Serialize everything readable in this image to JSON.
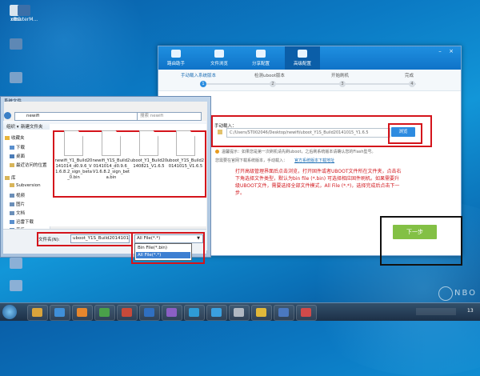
{
  "desktop": {
    "icons": [
      {
        "label": "nBO"
      },
      {
        "label": "xRouterM..."
      }
    ]
  },
  "tool_window": {
    "tabs": [
      {
        "label": "路由助手"
      },
      {
        "label": "文件浏览"
      },
      {
        "label": "分享配置"
      },
      {
        "label": "高级配置"
      }
    ],
    "steps": [
      {
        "label": "手动载入系统版本",
        "num": "1"
      },
      {
        "label": "检测uboot版本",
        "num": "2"
      },
      {
        "label": "开始刷机",
        "num": "3"
      },
      {
        "label": "完成",
        "num": "4"
      }
    ],
    "manual_load_label": "手动载入：",
    "path_value": "C:/Users/ST002046/Desktop/newifi/uboot_Y1S_Build20141015_Y1.6.5",
    "browse_label": "浏览",
    "tip": "温馨提示：如果您是第一次刷机请先刷uboot，之后刷系统版本请确认您的Flash型号。",
    "help_text": "您需要在官网下载系统版本，手动载入：",
    "help_link": "官方系统版本下载地址",
    "instructions": "打开高级管理界面后点击浏览，打开固件或者UBOOT文件所在文件夹，点击右下角选择文件类型，默认为bin file (*.bin) 可选择相应固件刷机。如果需要升级UBOOT文件，需要选择全部文件模式，All File (*.*)，选择完成后点击下一步。",
    "next_label": "下一步"
  },
  "explorer": {
    "title": "系统文件",
    "address": "newifi",
    "search_placeholder": "搜索 newifi",
    "toolbar": {
      "organize": "组织 ▾",
      "new_folder": "新建文件夹"
    },
    "nav": [
      {
        "label": "收藏夹"
      },
      {
        "label": "下载"
      },
      {
        "label": "桌面"
      },
      {
        "label": "最近访问的位置"
      },
      {
        "label": "库"
      },
      {
        "label": "Subversion"
      },
      {
        "label": "视频"
      },
      {
        "label": "图片"
      },
      {
        "label": "文档"
      },
      {
        "label": "迅雷下载"
      },
      {
        "label": "音乐"
      }
    ],
    "files": [
      {
        "name": "newifi_Y1_Build20141014_d0.9.6_V1.6.8.2_sign_beta_0.bin"
      },
      {
        "name": "newifi_Y1S_Build20141014_d0.9.6_V1.6.8.2_sign_beta.bin"
      },
      {
        "name": "uboot_Y1_Build20140821_V1.6.5"
      },
      {
        "name": "uboot_Y1S_Build20141015_V1.6.5"
      }
    ],
    "filename_label": "文件名(N):",
    "filename_value": "uboot_Y1S_Build20141015_V1.(",
    "filetype_value": "All File(*.*)",
    "filetype_options": [
      "Bin File(*.bin)",
      "All File(*.*)"
    ]
  },
  "watermark": "NBO",
  "clock": "13"
}
